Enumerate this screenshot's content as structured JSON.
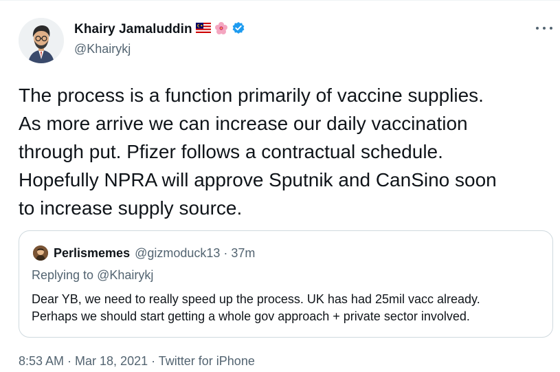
{
  "tweet": {
    "author": {
      "display_name": "Khairy Jamaluddin",
      "handle": "@Khairykj",
      "avatar_icon": "cartoon-avatar",
      "badge_emojis": [
        "malaysia-flag-icon",
        "hibiscus-icon"
      ],
      "verified_icon": "verified-badge-icon",
      "verified_color": "#1d9bf0"
    },
    "more_icon": "more-options-icon",
    "text_lines": [
      "The process is a function primarily of vaccine supplies.",
      "As more arrive we can increase our daily vaccination",
      "through put. Pfizer follows a contractual schedule.",
      "Hopefully NPRA will approve Sputnik and CanSino soon",
      "to increase supply source."
    ],
    "quoted": {
      "display_name": "Perlismemes",
      "handle_time": "@gizmoduck13 · 37m",
      "replying_prefix": "Replying to",
      "replying_to": "@Khairykj",
      "text_lines": [
        "Dear YB, we need to really speed up the process. UK has had 25mil vacc already.",
        "Perhaps we should start getting a whole gov approach + private sector involved."
      ]
    },
    "timestamp": "8:53 AM · Mar 18, 2021 · ",
    "source": "Twitter for iPhone"
  }
}
